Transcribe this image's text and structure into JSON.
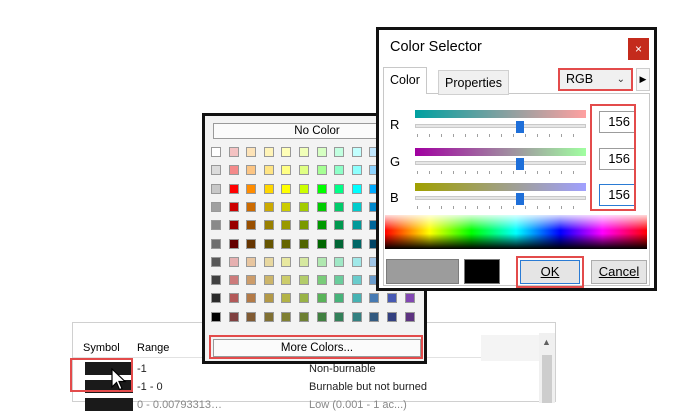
{
  "table": {
    "header_symbol": "Symbol",
    "header_range": "Range",
    "rows": [
      {
        "range": "-1",
        "description": "Non-burnable"
      },
      {
        "range": "-1 - 0",
        "description": "Burnable but not burned"
      },
      {
        "range": "0 - 0.00793313…",
        "description": "Low (0.001 - 1 ac...)"
      }
    ]
  },
  "palette": {
    "no_color_label": "No Color",
    "more_colors_label": "More Colors...",
    "swatches": [
      [
        "#ffffff",
        "#f4c2c2",
        "#fde3b8",
        "#fff4b8",
        "#ffffb8",
        "#f0ffb8",
        "#d6ffc2",
        "#c2ffe0",
        "#c2fffe",
        "#c2e8ff",
        "#c2c8ff",
        "#e2c2ff"
      ],
      [
        "#dcdcdc",
        "#f48a8a",
        "#fcc584",
        "#ffe584",
        "#ffff84",
        "#e0ff84",
        "#a6ff94",
        "#8effc8",
        "#8efffd",
        "#8ed4ff",
        "#8e9cff",
        "#cc8eff"
      ],
      [
        "#c8c8c8",
        "#ff0000",
        "#ff8c00",
        "#ffd700",
        "#ffff00",
        "#ccff00",
        "#00ff00",
        "#00ff88",
        "#00ffff",
        "#00aaff",
        "#2244ff",
        "#9900ff"
      ],
      [
        "#a0a0a0",
        "#cc0000",
        "#cc6a00",
        "#ccaa00",
        "#cccc00",
        "#a3cc00",
        "#00cc00",
        "#00cc6a",
        "#00cccc",
        "#0088cc",
        "#1b36cc",
        "#7a00cc"
      ],
      [
        "#8a8a8a",
        "#990000",
        "#994f00",
        "#998000",
        "#999900",
        "#7a9900",
        "#009900",
        "#00994f",
        "#009999",
        "#006699",
        "#142899",
        "#5c0099"
      ],
      [
        "#6e6e6e",
        "#660000",
        "#663500",
        "#665500",
        "#666600",
        "#516600",
        "#006600",
        "#006635",
        "#006666",
        "#004466",
        "#0d1b66",
        "#3d0066"
      ],
      [
        "#585858",
        "#e6b0b0",
        "#e8c6a0",
        "#e8d8a0",
        "#e8e8a0",
        "#d6e8a0",
        "#b0e8b0",
        "#a0e8c6",
        "#a0e8e8",
        "#a0c6e8",
        "#a0aae8",
        "#caa0e8"
      ],
      [
        "#404040",
        "#cc7a7a",
        "#cc9c6a",
        "#ccb56a",
        "#cccc6a",
        "#b3cc6a",
        "#7acc7a",
        "#6acc9c",
        "#6acccc",
        "#6a9ccc",
        "#6a7acc",
        "#a36acc"
      ],
      [
        "#2a2a2a",
        "#b35959",
        "#b37a47",
        "#b39947",
        "#b3b347",
        "#99b347",
        "#59b359",
        "#47b37a",
        "#47b3b3",
        "#477ab3",
        "#4759b3",
        "#8247b3"
      ],
      [
        "#000000",
        "#804040",
        "#805a33",
        "#807033",
        "#808033",
        "#6e8033",
        "#408040",
        "#338059",
        "#338080",
        "#335a80",
        "#334080",
        "#5d3380"
      ]
    ]
  },
  "dialog": {
    "title": "Color Selector",
    "close_label": "×",
    "tab_color": "Color",
    "tab_properties": "Properties",
    "model": "RGB",
    "channels": [
      {
        "label": "R",
        "value": "156",
        "level": 156,
        "gradient": [
          "#00a0a0",
          "#ffa0a0"
        ]
      },
      {
        "label": "G",
        "value": "156",
        "level": 156,
        "gradient": [
          "#a000a0",
          "#a0ffa0"
        ]
      },
      {
        "label": "B",
        "value": "156",
        "level": 156,
        "gradient": [
          "#a0a000",
          "#a0a0ff"
        ]
      }
    ],
    "new_color": "#9c9c9c",
    "old_color": "#000000",
    "ok_label": "OK",
    "cancel_label": "Cancel"
  }
}
